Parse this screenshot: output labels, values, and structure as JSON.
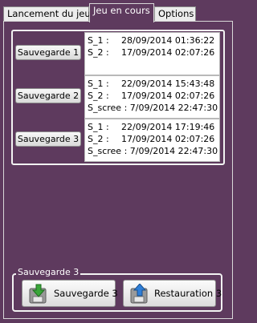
{
  "tabs": [
    "Lancement du jeu",
    "Jeu en cours",
    "Options"
  ],
  "slots": [
    {
      "button": "Sauvegarde 1",
      "lines": [
        {
          "key": "S_1 :",
          "value": "28/09/2014 01:36:22"
        },
        {
          "key": "S_2 :",
          "value": "17/09/2014 02:07:26"
        },
        {
          "key": "",
          "value": ""
        }
      ]
    },
    {
      "button": "Sauvegarde 2",
      "lines": [
        {
          "key": "S_1 :",
          "value": "22/09/2014 15:43:48"
        },
        {
          "key": "S_2 :",
          "value": "17/09/2014 02:07:26"
        },
        {
          "key": "S_scree :",
          "value": "7/09/2014 22:47:30"
        }
      ]
    },
    {
      "button": "Sauvegarde 3",
      "lines": [
        {
          "key": "S_1 :",
          "value": "22/09/2014 17:19:46"
        },
        {
          "key": "S_2 :",
          "value": "17/09/2014 02:07:26"
        },
        {
          "key": "S_scree :",
          "value": "7/09/2014 22:47:30"
        }
      ]
    }
  ],
  "group": {
    "title": "Sauvegarde 3",
    "save_label": "Sauvegarde 3",
    "restore_label": "Restauration 3",
    "save_icon": "download-disk-icon",
    "restore_icon": "upload-disk-icon"
  },
  "colors": {
    "background": "#5e3a5e",
    "frame": "#f2f2f2",
    "save_arrow": "#3aa63a",
    "restore_arrow": "#2f7fd8"
  }
}
